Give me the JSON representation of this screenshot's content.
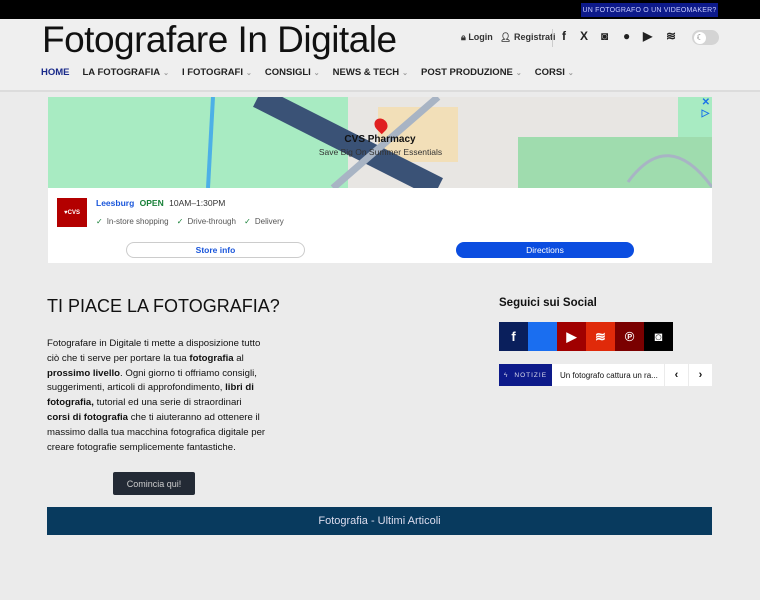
{
  "topbar": {
    "cta": "UN FOTOGRAFO O UN VIDEOMAKER?"
  },
  "header": {
    "logo": "Fotografare In Digitale",
    "login": "Login",
    "register": "Registrati"
  },
  "nav": [
    {
      "label": "HOME"
    },
    {
      "label": "LA FOTOGRAFIA"
    },
    {
      "label": "I FOTOGRAFI"
    },
    {
      "label": "CONSIGLI"
    },
    {
      "label": "NEWS & TECH"
    },
    {
      "label": "POST PRODUZIONE"
    },
    {
      "label": "CORSI"
    }
  ],
  "ad": {
    "title": "CVS Pharmacy",
    "subtitle": "Save Big On Summer Essentials",
    "logo": "♥CVS",
    "city": "Leesburg",
    "status": "OPEN",
    "hours": "10AM–1:30PM",
    "features": [
      "In-store shopping",
      "Drive-through",
      "Delivery"
    ],
    "store_info": "Store info",
    "directions": "Directions"
  },
  "intro": {
    "heading": "TI PIACE LA FOTOGRAFIA?",
    "p": [
      "Fotografare in Digitale ti mette a disposizione tutto ciò che ti serve per portare la tua ",
      "fotografia",
      " al ",
      "prossimo livello",
      ". Ogni giorno ti offriamo consigli, suggerimenti, articoli di approfondimento, ",
      "libri di fotografia,",
      " tutorial ed una serie di straordinari ",
      "corsi di fotografia",
      " che ti aiuteranno ad ottenere il massimo dalla tua macchina fotografica digitale per creare fotografie semplicemente fantastiche."
    ],
    "button": "Comincia qui!"
  },
  "latest_bar": "Fotografia - Ultimi Articoli",
  "social": {
    "heading": "Seguici sui Social",
    "colors": [
      "#0a1f5c",
      "#1a6ef0",
      "#a00000",
      "#e02a0a",
      "#7a0000",
      "#000000"
    ]
  },
  "ticker": {
    "label": "NOTIZIE",
    "text": "Un fotografo cattura un ra..."
  }
}
